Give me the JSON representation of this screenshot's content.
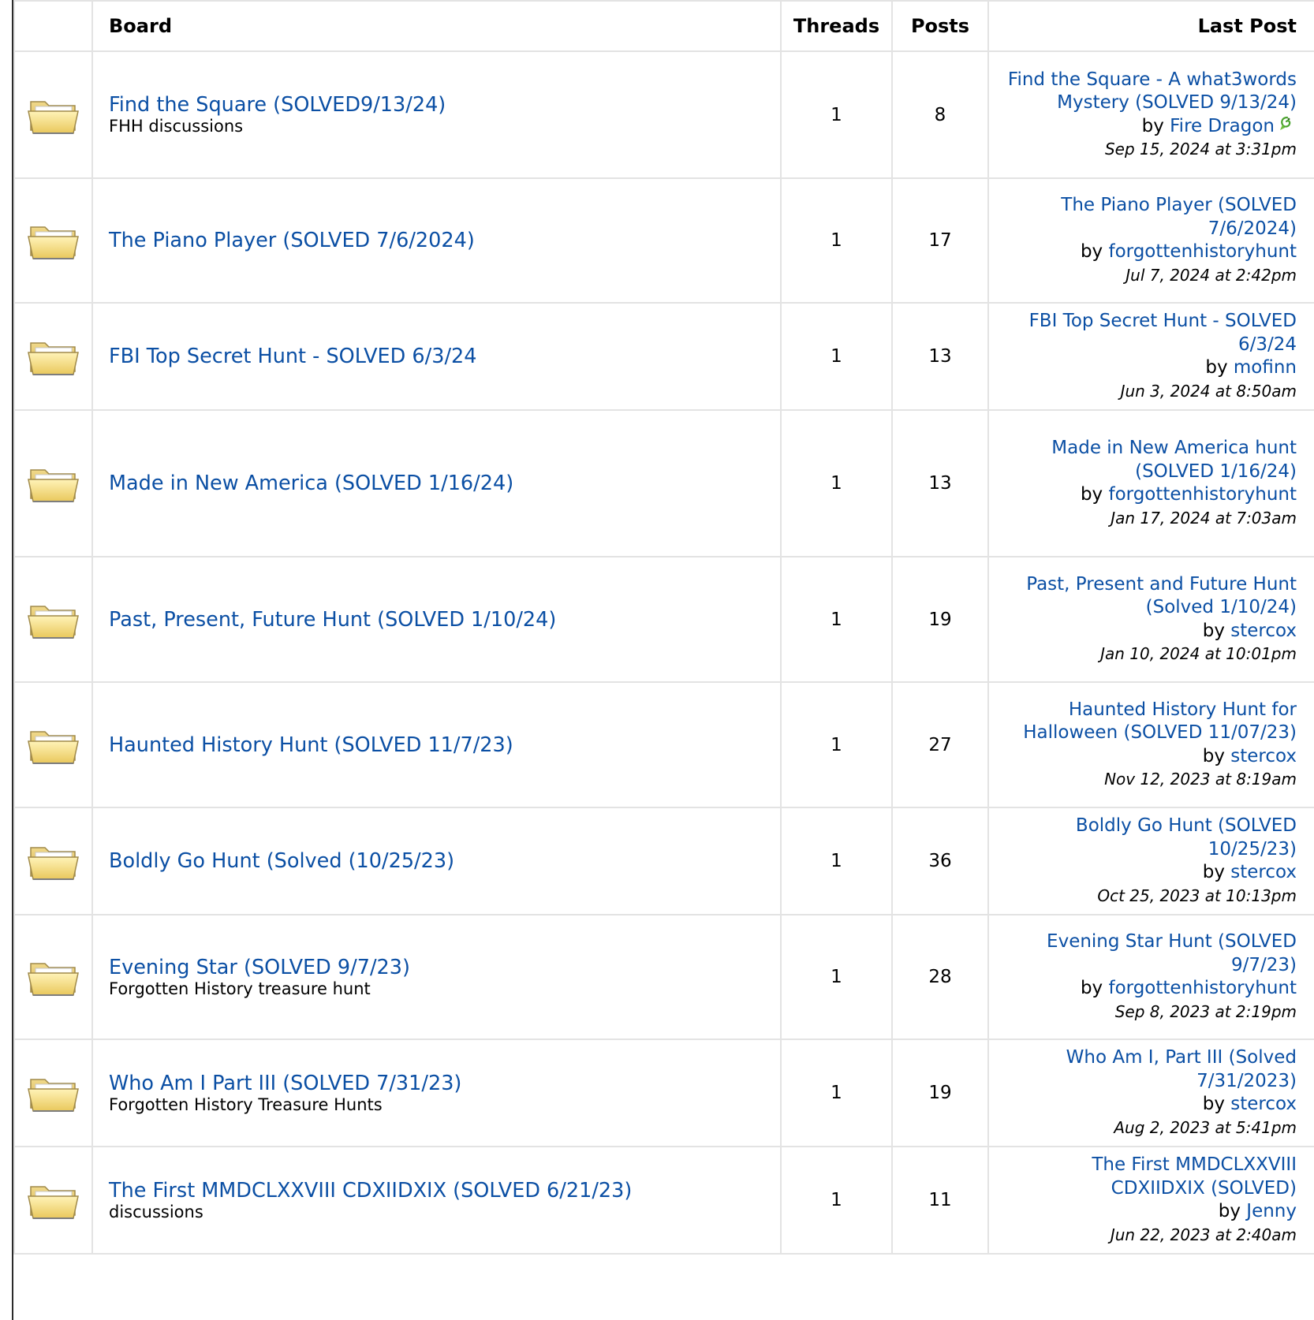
{
  "header": {
    "board": "Board",
    "threads": "Threads",
    "posts": "Posts",
    "last_post": "Last Post"
  },
  "rows": [
    {
      "title": "Find the Square (SOLVED9/13/24)",
      "desc": "FHH discussions",
      "threads": "1",
      "posts": "8",
      "last_title": "Find the Square - A what3words Mystery (SOLVED 9/13/24)",
      "by": "by",
      "user": "Fire Dragon",
      "user_badge": "dragon-icon",
      "date": "Sep 15, 2024 at 3:31pm"
    },
    {
      "title": "The Piano Player (SOLVED 7/6/2024)",
      "desc": "",
      "threads": "1",
      "posts": "17",
      "last_title": "The Piano Player (SOLVED 7/6/2024)",
      "by": "by",
      "user": "forgottenhistoryhunt",
      "date": "Jul 7, 2024 at 2:42pm"
    },
    {
      "title": "FBI Top Secret Hunt - SOLVED 6/3/24",
      "desc": "",
      "threads": "1",
      "posts": "13",
      "last_title": "FBI Top Secret Hunt - SOLVED 6/3/24",
      "by": "by",
      "user": "mofinn",
      "date": "Jun 3, 2024 at 8:50am"
    },
    {
      "title": "Made in New America (SOLVED 1/16/24)",
      "desc": "",
      "threads": "1",
      "posts": "13",
      "last_title": "Made in New America hunt (SOLVED 1/16/24)",
      "by": "by",
      "user": "forgottenhistoryhunt",
      "date": "Jan 17, 2024 at 7:03am"
    },
    {
      "title": "Past, Present, Future Hunt (SOLVED 1/10/24)",
      "desc": "",
      "threads": "1",
      "posts": "19",
      "last_title": "Past, Present and Future Hunt (Solved 1/10/24)",
      "by": "by",
      "user": "stercox",
      "date": "Jan 10, 2024 at 10:01pm"
    },
    {
      "title": "Haunted History Hunt (SOLVED 11/7/23)",
      "desc": "",
      "threads": "1",
      "posts": "27",
      "last_title": "Haunted History Hunt for Halloween (SOLVED 11/07/23)",
      "by": "by",
      "user": "stercox",
      "date": "Nov 12, 2023 at 8:19am"
    },
    {
      "title": "Boldly Go Hunt (Solved (10/25/23)",
      "desc": "",
      "threads": "1",
      "posts": "36",
      "last_title": "Boldly Go Hunt (SOLVED 10/25/23)",
      "by": "by",
      "user": "stercox",
      "date": "Oct 25, 2023 at 10:13pm"
    },
    {
      "title": "Evening Star (SOLVED 9/7/23)",
      "desc": "Forgotten History treasure hunt",
      "threads": "1",
      "posts": "28",
      "last_title": "Evening Star Hunt (SOLVED 9/7/23)",
      "by": "by",
      "user": "forgottenhistoryhunt",
      "date": "Sep 8, 2023 at 2:19pm"
    },
    {
      "title": "Who Am I Part III (SOLVED 7/31/23)",
      "desc": "Forgotten History Treasure Hunts",
      "threads": "1",
      "posts": "19",
      "last_title": "Who Am I, Part III (Solved 7/31/2023)",
      "by": "by",
      "user": "stercox",
      "date": "Aug 2, 2023 at 5:41pm"
    },
    {
      "title": "The First MMDCLXXVIII CDXIIDXIX (SOLVED 6/21/23)",
      "desc": "discussions",
      "threads": "1",
      "posts": "11",
      "last_title": "The First MMDCLXXVIII CDXIIDXIX (SOLVED)",
      "by": "by",
      "user": "Jenny",
      "date": "Jun 22, 2023 at 2:40am"
    }
  ],
  "colors": {
    "link": "#0b4fa4",
    "grid": "#e3e3e3",
    "folder": "#f3dc8a"
  },
  "icons": {
    "board_folder": "folder-icon"
  }
}
